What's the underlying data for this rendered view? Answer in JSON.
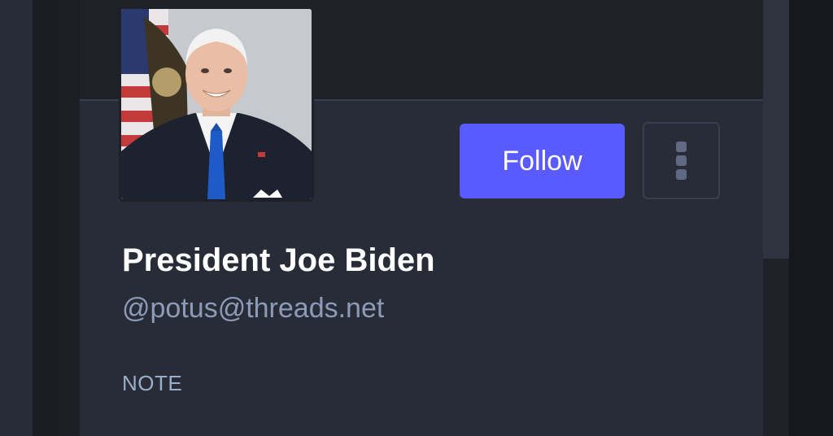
{
  "profile": {
    "display_name": "President Joe Biden",
    "handle": "@potus@threads.net",
    "avatar_alt": "President Joe Biden"
  },
  "actions": {
    "follow_label": "Follow",
    "more_icon": "kebab-menu-icon"
  },
  "sections": {
    "note_label": "NOTE"
  },
  "colors": {
    "accent": "#595aff",
    "background": "#282c37",
    "text_primary": "#ffffff",
    "text_secondary": "#8e9bb8"
  }
}
